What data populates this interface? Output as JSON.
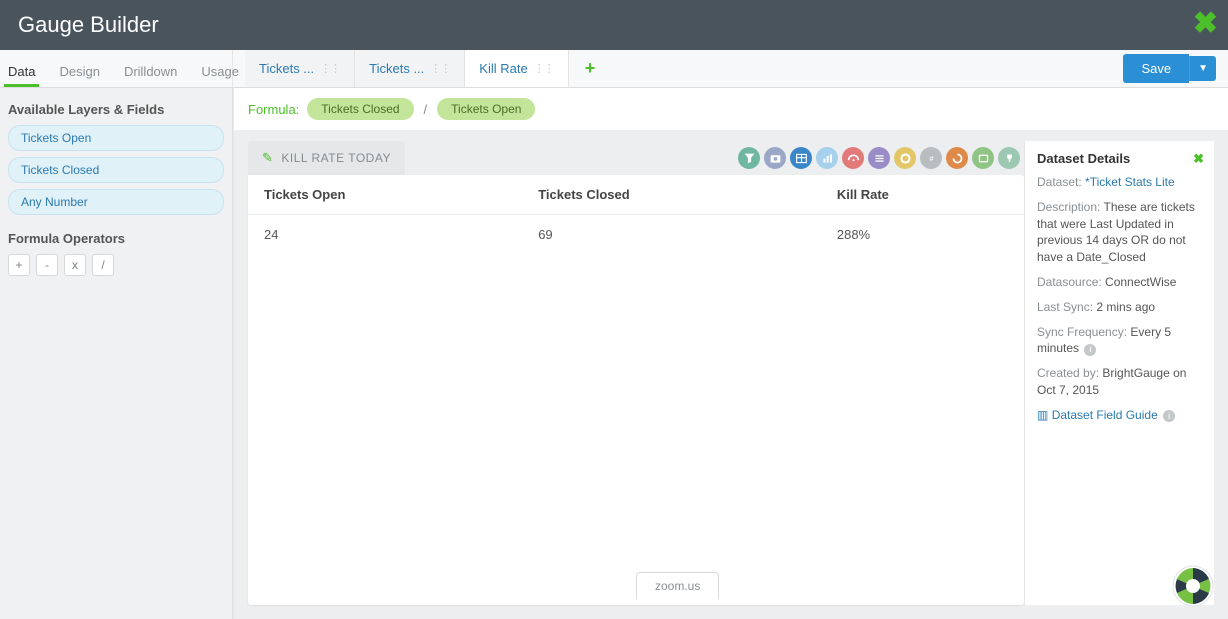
{
  "header": {
    "title": "Gauge Builder"
  },
  "left_tabs": [
    "Data",
    "Design",
    "Drilldown",
    "Usage"
  ],
  "left_active": 0,
  "doc_tabs": [
    "Tickets ...",
    "Tickets ...",
    "Kill Rate"
  ],
  "doc_active": 2,
  "save_label": "Save",
  "sidebar": {
    "layers_title": "Available Layers & Fields",
    "layers": [
      "Tickets Open",
      "Tickets Closed",
      "Any Number"
    ],
    "ops_title": "Formula Operators",
    "ops": [
      "+",
      "-",
      "x",
      "/"
    ]
  },
  "formula": {
    "label": "Formula:",
    "chips": [
      "Tickets Closed",
      "Tickets Open"
    ],
    "op": "/"
  },
  "card": {
    "title": "KILL RATE TODAY",
    "icon_colors": [
      "#6fb7a1",
      "#9aa7c7",
      "#3b86c8",
      "#a7d0ec",
      "#e37a7a",
      "#9a8cc6",
      "#e3c668",
      "#b9bdc0",
      "#e08a4a",
      "#8fc484",
      "#9cc7b2"
    ],
    "columns": [
      "Tickets Open",
      "Tickets Closed",
      "Kill Rate"
    ],
    "row": [
      "24",
      "69",
      "288%"
    ]
  },
  "details": {
    "title": "Dataset Details",
    "dataset_k": "Dataset:",
    "dataset_v": "*Ticket Stats Lite",
    "desc_k": "Description:",
    "desc_v": "These are tickets that were Last Updated in previous 14 days OR do not have a Date_Closed",
    "ds_k": "Datasource:",
    "ds_v": "ConnectWise",
    "sync_k": "Last Sync:",
    "sync_v": "2 mins ago",
    "freq_k": "Sync Frequency:",
    "freq_v": "Every 5 minutes",
    "created_k": "Created by:",
    "created_v": "BrightGauge on Oct 7, 2015",
    "guide": "Dataset Field Guide"
  },
  "zoom_label": "zoom.us"
}
